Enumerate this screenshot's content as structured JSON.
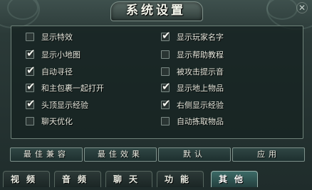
{
  "window": {
    "title": "系统设置"
  },
  "options_left": [
    {
      "label": "显示特效",
      "checked": false
    },
    {
      "label": "显示小地图",
      "checked": true
    },
    {
      "label": "自动寻径",
      "checked": true
    },
    {
      "label": "和主包裹一起打开",
      "checked": true
    },
    {
      "label": "头顶显示经验",
      "checked": true
    },
    {
      "label": "聊天优化",
      "checked": false
    }
  ],
  "options_right": [
    {
      "label": "显示玩家名字",
      "checked": true
    },
    {
      "label": "显示帮助教程",
      "checked": false
    },
    {
      "label": "被攻击提示音",
      "checked": false
    },
    {
      "label": "显示地上物品",
      "checked": true
    },
    {
      "label": "右侧显示经验",
      "checked": true
    },
    {
      "label": "自动拣取物品",
      "checked": false
    }
  ],
  "actions": {
    "best_compat": "最佳兼容",
    "best_effect": "最佳效果",
    "default": "默认",
    "apply": "应用"
  },
  "tabs": [
    {
      "label": "视频",
      "active": false
    },
    {
      "label": "音频",
      "active": false
    },
    {
      "label": "聊天",
      "active": false
    },
    {
      "label": "功能",
      "active": false
    },
    {
      "label": "其他",
      "active": true
    }
  ]
}
